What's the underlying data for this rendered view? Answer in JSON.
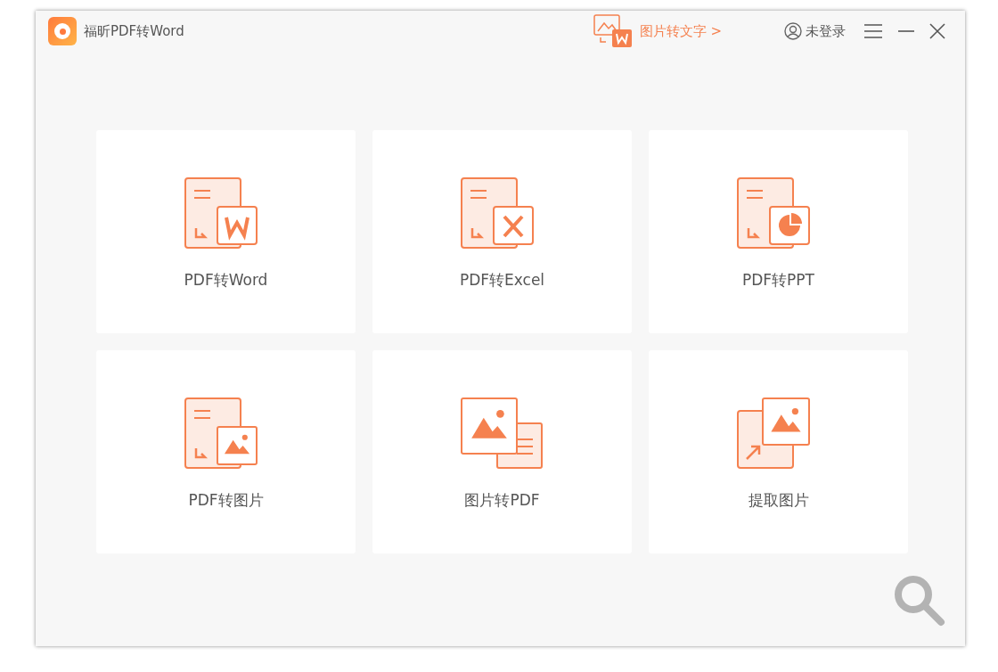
{
  "app": {
    "title": "福昕PDF转Word"
  },
  "promo": {
    "label": "图片转文字 >"
  },
  "account": {
    "label": "未登录"
  },
  "tools": [
    {
      "label": "PDF转Word",
      "kind": "word"
    },
    {
      "label": "PDF转Excel",
      "kind": "excel"
    },
    {
      "label": "PDF转PPT",
      "kind": "ppt"
    },
    {
      "label": "PDF转图片",
      "kind": "pdf-image"
    },
    {
      "label": "图片转PDF",
      "kind": "image-pdf"
    },
    {
      "label": "提取图片",
      "kind": "extract"
    }
  ]
}
